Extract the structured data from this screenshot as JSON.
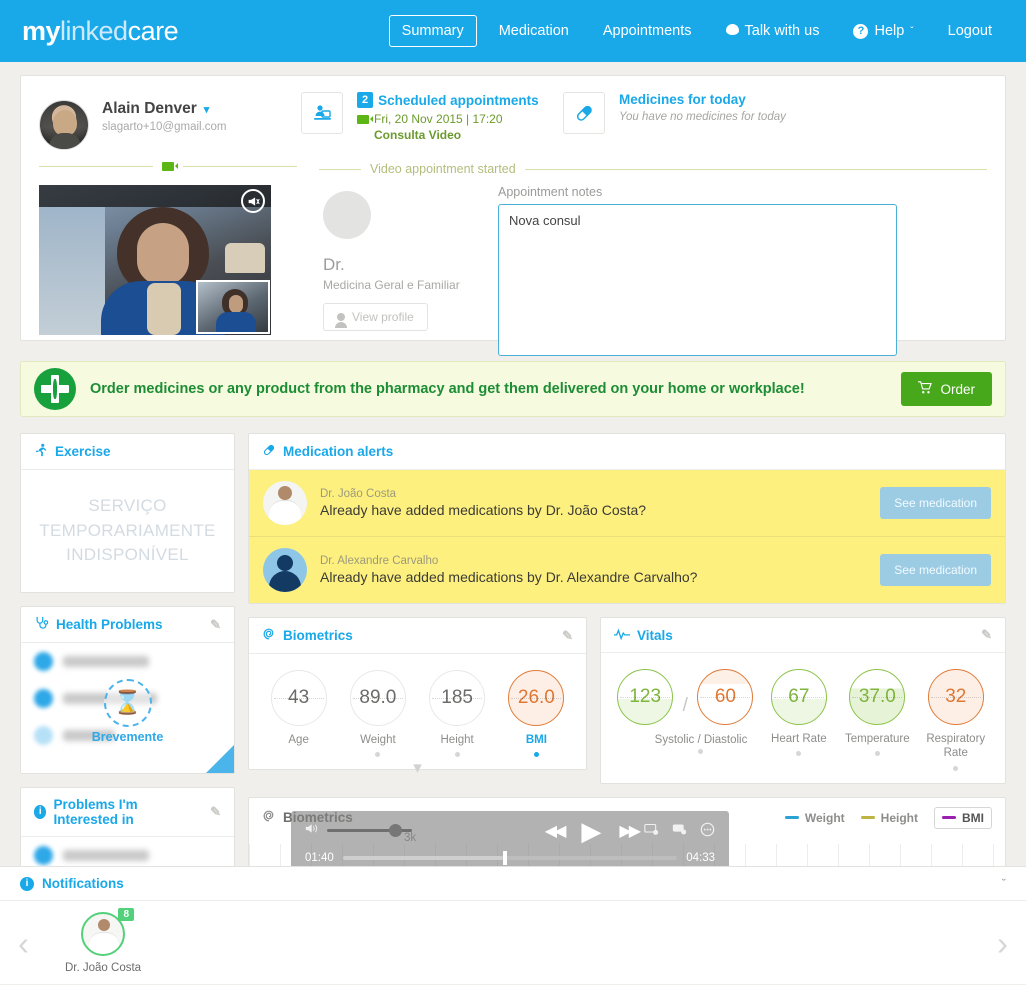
{
  "brand": {
    "part1": "my",
    "part2": "linked",
    "part3": "care"
  },
  "nav": {
    "items": [
      {
        "label": "Summary",
        "icon": "",
        "active": true
      },
      {
        "label": "Medication",
        "icon": "",
        "active": false
      },
      {
        "label": "Appointments",
        "icon": "",
        "active": false
      },
      {
        "label": "Talk with us",
        "icon": "chat-bubble-icon",
        "active": false
      },
      {
        "label": "Help",
        "icon": "question-circle-icon",
        "active": false
      },
      {
        "label": "Logout",
        "icon": "",
        "active": false
      }
    ],
    "help_caret": "ˇ"
  },
  "user": {
    "name": "Alain Denver",
    "email": "slagarto+10@gmail.com",
    "caret": "▾"
  },
  "appointments": {
    "count": "2",
    "title": "Scheduled appointments",
    "datetime": "Fri, 20 Nov 2015 | 17:20",
    "type": "Consulta Video"
  },
  "medicines": {
    "title": "Medicines for today",
    "subtitle": "You have no medicines for today"
  },
  "video_divider_label": "Video appointment started",
  "doctor": {
    "name": "Dr.",
    "specialty": "Medicina Geral e Familiar",
    "view_profile": "View profile"
  },
  "notes": {
    "label": "Appointment notes",
    "value": "Nova consul",
    "placeholder": ""
  },
  "pharmacy": {
    "message": "Order medicines or any product from the pharmacy and get them delivered on your home or workplace!",
    "order_label": "Order",
    "cart_icon": "🛒"
  },
  "exercise": {
    "title": "Exercise",
    "unavailable": "SERVIÇO TEMPORARIAMENTE INDISPONÍVEL"
  },
  "health_problems": {
    "title": "Health Problems",
    "soon_label": "Brevemente",
    "hourglass": "⌛",
    "add": "+"
  },
  "problems_interested": {
    "title": "Problems I'm Interested in"
  },
  "medication_alerts": {
    "title": "Medication alerts",
    "rows": [
      {
        "who": "Dr. João Costa",
        "message": "Already have added medications by Dr. João Costa?",
        "button": "See medication"
      },
      {
        "who": "Dr. Alexandre Carvalho",
        "message": "Already have added medications by Dr. Alexandre Carvalho?",
        "button": "See medication"
      }
    ]
  },
  "biometrics": {
    "title": "Biometrics",
    "metrics": [
      {
        "value": "43",
        "label": "Age",
        "state": "plain",
        "selected": false,
        "dot": false
      },
      {
        "value": "89.0",
        "label": "Weight",
        "state": "plain",
        "selected": false,
        "dot": true
      },
      {
        "value": "185",
        "label": "Height",
        "state": "plain",
        "selected": false,
        "dot": true
      },
      {
        "value": "26.0",
        "label": "BMI",
        "state": "orange-fill",
        "selected": true,
        "dot": true
      }
    ]
  },
  "vitals": {
    "title": "Vitals",
    "metrics": [
      {
        "value": "123",
        "label": "Systolic / Diastolic",
        "state": "green",
        "dot": true
      },
      {
        "value": "60",
        "label": "",
        "state": "orange",
        "dot": false
      },
      {
        "value": "67",
        "label": "Heart Rate",
        "state": "green",
        "dot": true
      },
      {
        "value": "37.0",
        "label": "Temperature",
        "state": "green-hi",
        "dot": true
      },
      {
        "value": "32",
        "label": "Respiratory Rate",
        "state": "orange-fill",
        "dot": true
      }
    ],
    "separator": "/"
  },
  "chart_data": {
    "type": "line",
    "title": "Biometrics",
    "xlabel": "",
    "ylabel": "",
    "ytick_labels": [
      "3k"
    ],
    "series": [
      {
        "name": "Weight",
        "color": "#2aa3d4",
        "values": []
      },
      {
        "name": "Height",
        "color": "#bfb441",
        "values": []
      },
      {
        "name": "BMI",
        "color": "#9b1fb0",
        "values": [],
        "selected": true
      }
    ],
    "legend_position": "top-right",
    "grid": true
  },
  "player": {
    "current_time": "01:40",
    "total_time": "04:33",
    "speaker_icon": "🔊",
    "prev_icon": "◀◀",
    "play_icon": "▶",
    "next_icon": "▶▶",
    "screen_icon": "⬜",
    "chat_icon": "▤",
    "more_icon": "⋯"
  },
  "notifications": {
    "title": "Notifications",
    "chevron": "ˇ",
    "prev_arrow": "‹",
    "next_arrow": "›",
    "items": [
      {
        "name": "Dr. João Costa",
        "badge": "8"
      }
    ]
  },
  "colors": {
    "brand_blue": "#19a8e8",
    "green": "#46a81a",
    "alert_yellow": "#fdf07f",
    "orange": "#e07b39",
    "olive": "#b5bd7d"
  }
}
